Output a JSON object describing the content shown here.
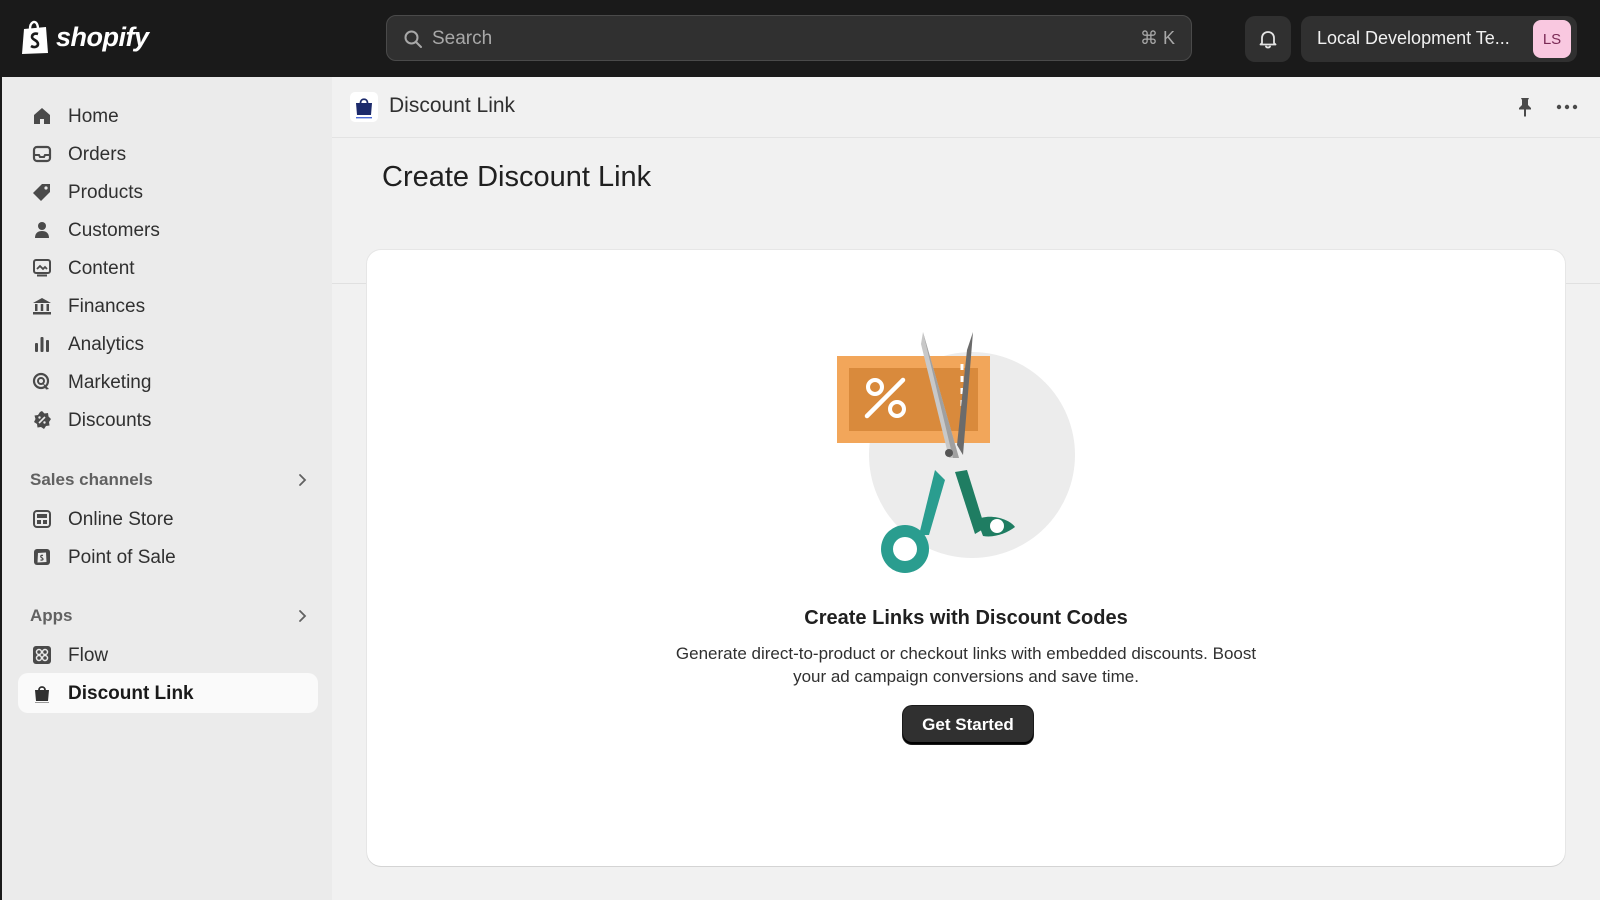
{
  "topbar": {
    "brand": "shopify",
    "search_placeholder": "Search",
    "search_shortcut": "⌘ K",
    "store_name": "Local Development Te...",
    "avatar_initials": "LS"
  },
  "sidebar": {
    "items": [
      {
        "label": "Home",
        "icon": "home-icon"
      },
      {
        "label": "Orders",
        "icon": "orders-icon"
      },
      {
        "label": "Products",
        "icon": "tag-icon"
      },
      {
        "label": "Customers",
        "icon": "person-icon"
      },
      {
        "label": "Content",
        "icon": "content-icon"
      },
      {
        "label": "Finances",
        "icon": "bank-icon"
      },
      {
        "label": "Analytics",
        "icon": "bar-chart-icon"
      },
      {
        "label": "Marketing",
        "icon": "target-icon"
      },
      {
        "label": "Discounts",
        "icon": "discount-badge-icon"
      }
    ],
    "sales_channels": {
      "heading": "Sales channels",
      "items": [
        {
          "label": "Online Store",
          "icon": "storefront-icon"
        },
        {
          "label": "Point of Sale",
          "icon": "pos-icon"
        }
      ]
    },
    "apps": {
      "heading": "Apps",
      "items": [
        {
          "label": "Flow",
          "icon": "flow-icon"
        },
        {
          "label": "Discount Link",
          "icon": "shopping-bag-icon",
          "active": true
        }
      ]
    }
  },
  "app_header": {
    "title": "Discount Link"
  },
  "page": {
    "title": "Create Discount Link",
    "empty_state": {
      "heading": "Create Links with Discount Codes",
      "description": "Generate direct-to-product or checkout links with embedded discounts. Boost your ad campaign conversions and save time.",
      "cta_label": "Get Started"
    }
  },
  "colors": {
    "topbar_bg": "#1a1a1a",
    "sidebar_bg": "#ebebeb",
    "main_bg": "#f1f1f1",
    "coupon_orange": "#f2a65a",
    "scissors_teal": "#2a9d8f",
    "button_dark": "#303030"
  }
}
